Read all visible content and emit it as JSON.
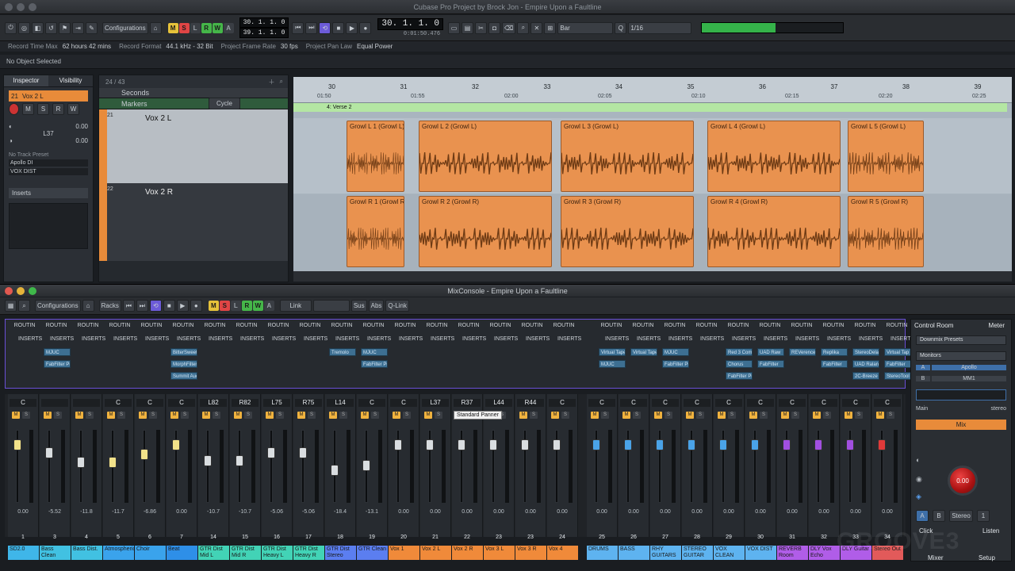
{
  "window": {
    "title": "Cubase Pro Project by Brock Jon - Empire Upon a Faultline"
  },
  "toolbar": {
    "configurations": "Configurations",
    "msrwa": [
      "M",
      "S",
      "L",
      "R",
      "W",
      "A"
    ],
    "locators": [
      "30. 1. 1. 0",
      "39. 1. 1. 0"
    ],
    "position": "30. 1. 1. 0",
    "timecode": "0:01:50.476",
    "grid": "Bar",
    "quantize": "1/16"
  },
  "info": {
    "items": [
      {
        "label": "Record Time Max",
        "value": "62 hours 42 mins"
      },
      {
        "label": "Record Format",
        "value": "44.1 kHz - 32 Bit"
      },
      {
        "label": "Project Frame Rate",
        "value": "30 fps"
      },
      {
        "label": "Project Pan Law",
        "value": "Equal Power"
      }
    ],
    "no_object": "No Object Selected"
  },
  "inspector": {
    "tabs": [
      "Inspector",
      "Visibility"
    ],
    "track": "Vox 2 L",
    "num": "21",
    "volume": "0.00",
    "pan": "L37",
    "pan_val": "0.00",
    "no_preset": "No Track Preset",
    "inputs": [
      "Apollo DI",
      "VOX DIST"
    ],
    "inserts": "Inserts"
  },
  "tracklist": {
    "count": "24 / 43",
    "seconds": "Seconds",
    "markers": "Markers",
    "cycle": "Cycle",
    "tracks": [
      {
        "num": "21",
        "name": "Vox 2 L"
      },
      {
        "num": "22",
        "name": "Vox 2 R"
      }
    ]
  },
  "ruler": {
    "bars": [
      "30",
      "31",
      "32",
      "33",
      "34",
      "35",
      "36",
      "37",
      "38",
      "39"
    ],
    "times": [
      "01:50",
      "01:55",
      "02:00",
      "02:05",
      "02:10",
      "02:15",
      "02:20",
      "02:25"
    ],
    "marker": "4: Verse 2"
  },
  "clips": [
    {
      "name": "Growl L 1 (Growl L)",
      "lane": 0
    },
    {
      "name": "Growl L 2 (Growl L)",
      "lane": 0
    },
    {
      "name": "Growl L 3 (Growl L)",
      "lane": 0
    },
    {
      "name": "Growl L 4 (Growl L)",
      "lane": 0
    },
    {
      "name": "Growl L 5 (Growl L)",
      "lane": 0
    },
    {
      "name": "Growl R 1 (Growl R)",
      "lane": 1
    },
    {
      "name": "Growl R 2 (Growl R)",
      "lane": 1
    },
    {
      "name": "Growl R 3 (Growl R)",
      "lane": 1
    },
    {
      "name": "Growl R 4 (Growl R)",
      "lane": 1
    },
    {
      "name": "Growl R 5 (Growl R)",
      "lane": 1
    }
  ],
  "mixconsole": {
    "title": "MixConsole - Empire Upon a Faultline",
    "configurations": "Configurations",
    "racks": "Racks",
    "link": "Link",
    "sus": "Sus",
    "abs": "Abs",
    "qlink": "Q-Link",
    "routing": "ROUTIN",
    "inserts": "INSERTS",
    "tooltip": "Standard Panner"
  },
  "inserts": [
    {
      "col": 1,
      "items": [
        "MJUC",
        "FabFilter Pr"
      ]
    },
    {
      "col": 5,
      "items": [
        "BitterSweet",
        "MorphFilter",
        "Summit Aud"
      ]
    },
    {
      "col": 10,
      "items": [
        "Tremolo"
      ]
    },
    {
      "col": 11,
      "items": [
        "MJUC",
        "FabFilter Pr"
      ]
    },
    {
      "col": 18,
      "items": [
        "Virtual Tape",
        "MJUC"
      ]
    },
    {
      "col": 19,
      "items": [
        "Virtual Tape"
      ]
    },
    {
      "col": 20,
      "items": [
        "MJUC",
        "FabFilter Pr"
      ]
    },
    {
      "col": 22,
      "items": [
        "Red 3 Comp",
        "Chorus",
        "FabFilter Pro"
      ]
    },
    {
      "col": 23,
      "items": [
        "UAD Raw",
        "FabFilter"
      ]
    },
    {
      "col": 24,
      "items": [
        "REVerence"
      ]
    },
    {
      "col": 25,
      "items": [
        "Replika",
        "FabFilter"
      ]
    },
    {
      "col": 26,
      "items": [
        "StereoDelay",
        "UAD Ralane",
        "2C-Breeze"
      ]
    },
    {
      "col": 27,
      "items": [
        "Virtual Tap",
        "FabFilter",
        "StereoTool"
      ]
    }
  ],
  "channels": [
    {
      "num": "1",
      "name": "SD2.0",
      "pan": "C",
      "db": "0.00",
      "color": "#3fb6e9",
      "cap": "#f2e28a",
      "level": 0.85
    },
    {
      "num": "3",
      "name": "Bass Clean",
      "pan": "",
      "db": "-5.52",
      "color": "#41c1e2",
      "cap": "#d9dde0",
      "level": 0.72
    },
    {
      "num": "4",
      "name": "Bass Dist.",
      "pan": "",
      "db": "-11.8",
      "color": "#41c1e2",
      "cap": "#d9dde0",
      "level": 0.58
    },
    {
      "num": "5",
      "name": "Atmospheric",
      "pan": "C",
      "db": "-11.7",
      "color": "#3aa3ec",
      "cap": "#f2e28a",
      "level": 0.58
    },
    {
      "num": "6",
      "name": "Choir",
      "pan": "C",
      "db": "-6.86",
      "color": "#3aa3ec",
      "cap": "#f2e28a",
      "level": 0.7
    },
    {
      "num": "7",
      "name": "Beat",
      "pan": "C",
      "db": "0.00",
      "color": "#2e8fe8",
      "cap": "#f2e28a",
      "level": 0.85
    },
    {
      "num": "14",
      "name": "GTR Dist Mid L",
      "pan": "L82",
      "db": "-10.7",
      "color": "#42d3b6",
      "cap": "#d9dde0",
      "level": 0.6
    },
    {
      "num": "15",
      "name": "GTR Dist Mid R",
      "pan": "R82",
      "db": "-10.7",
      "color": "#42d3b6",
      "cap": "#d9dde0",
      "level": 0.6
    },
    {
      "num": "16",
      "name": "GTR Dist Heavy L",
      "pan": "L75",
      "db": "-5.06",
      "color": "#42d3b6",
      "cap": "#d9dde0",
      "level": 0.72
    },
    {
      "num": "17",
      "name": "GTR Dist Heavy R",
      "pan": "R75",
      "db": "-5.06",
      "color": "#42d3b6",
      "cap": "#d9dde0",
      "level": 0.72
    },
    {
      "num": "18",
      "name": "GTR Dist Stereo",
      "pan": "L14",
      "db": "-18.4",
      "color": "#5b7ef0",
      "cap": "#d9dde0",
      "level": 0.45
    },
    {
      "num": "19",
      "name": "GTR Clean",
      "pan": "C",
      "db": "-13.1",
      "color": "#5b7ef0",
      "cap": "#d9dde0",
      "level": 0.52
    },
    {
      "num": "20",
      "name": "Vox 1",
      "pan": "C",
      "db": "0.00",
      "color": "#f08a3a",
      "cap": "#d9dde0",
      "level": 0.85
    },
    {
      "num": "21",
      "name": "Vox 2 L",
      "pan": "L37",
      "db": "0.00",
      "color": "#f08a3a",
      "cap": "#d9dde0",
      "level": 0.85
    },
    {
      "num": "22",
      "name": "Vox 2 R",
      "pan": "R37",
      "db": "0.00",
      "color": "#f08a3a",
      "cap": "#d9dde0",
      "level": 0.85
    },
    {
      "num": "23",
      "name": "Vox 3 L",
      "pan": "L44",
      "db": "0.00",
      "color": "#f08a3a",
      "cap": "#d9dde0",
      "level": 0.85
    },
    {
      "num": "23",
      "name": "Vox 3 R",
      "pan": "R44",
      "db": "0.00",
      "color": "#f08a3a",
      "cap": "#d9dde0",
      "level": 0.85
    },
    {
      "num": "24",
      "name": "Vox 4",
      "pan": "C",
      "db": "0.00",
      "color": "#f08a3a",
      "cap": "#d9dde0",
      "level": 0.85
    }
  ],
  "groups": [
    {
      "num": "25",
      "name": "DRUMS",
      "pan": "C",
      "db": "0.00",
      "color": "#5eb3f0",
      "cap": "#4aa3e8"
    },
    {
      "num": "26",
      "name": "BASS",
      "pan": "C",
      "db": "0.00",
      "color": "#5eb3f0",
      "cap": "#4aa3e8"
    },
    {
      "num": "27",
      "name": "RHY GUITARS",
      "pan": "C",
      "db": "0.00",
      "color": "#5eb3f0",
      "cap": "#4aa3e8"
    },
    {
      "num": "28",
      "name": "STEREO GUITAR",
      "pan": "C",
      "db": "0.00",
      "color": "#5eb3f0",
      "cap": "#4aa3e8"
    },
    {
      "num": "29",
      "name": "VOX CLEAN",
      "pan": "C",
      "db": "0.00",
      "color": "#5eb3f0",
      "cap": "#4aa3e8"
    },
    {
      "num": "30",
      "name": "VOX DIST",
      "pan": "C",
      "db": "0.00",
      "color": "#5eb3f0",
      "cap": "#4aa3e8"
    },
    {
      "num": "31",
      "name": "REVERB Room",
      "pan": "C",
      "db": "0.00",
      "color": "#b05de8",
      "cap": "#a14fe0"
    },
    {
      "num": "32",
      "name": "DLY Vox Echo",
      "pan": "C",
      "db": "0.00",
      "color": "#b05de8",
      "cap": "#a14fe0"
    },
    {
      "num": "33",
      "name": "DLY Guitar",
      "pan": "C",
      "db": "0.00",
      "color": "#b05de8",
      "cap": "#a14fe0"
    },
    {
      "num": "34",
      "name": "Stereo Out",
      "pan": "C",
      "db": "0.00",
      "color": "#e25a5a",
      "cap": "#e03a3a"
    }
  ],
  "control_room": {
    "tabs": [
      "Control Room",
      "Meter"
    ],
    "downmix": "Downmix Presets",
    "monitors": "Monitors",
    "outputs": [
      {
        "key": "A",
        "name": "Apollo"
      },
      {
        "key": "B",
        "name": "MM1"
      }
    ],
    "main": "Main",
    "main_fmt": "stereo",
    "mix": "Mix",
    "level": "0.00",
    "bottom": [
      "A",
      "B",
      "Stereo",
      "1"
    ],
    "click": "Click",
    "listen": "Listen"
  },
  "footer": {
    "mixer": "Mixer",
    "setup": "Setup"
  },
  "watermark": "GROOVE3"
}
